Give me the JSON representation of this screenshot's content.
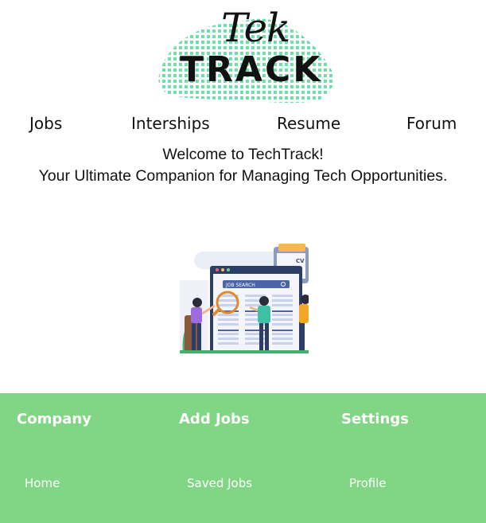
{
  "logo": {
    "line1": "Tek",
    "line2": "TRACK",
    "dot_colors": [
      "#4fd6e6",
      "#7be36b"
    ]
  },
  "nav": {
    "items": [
      {
        "label": "Jobs"
      },
      {
        "label": "Interships"
      },
      {
        "label": "Resume"
      },
      {
        "label": "Forum"
      }
    ]
  },
  "welcome": {
    "line1": "Welcome to TechTrack!",
    "line2": "Your Ultimate Companion for Managing Tech Opportunities."
  },
  "illustration": {
    "search_label": "JOB SEARCH",
    "cv_label": "CV"
  },
  "footer": {
    "background": "#80d684",
    "columns": [
      {
        "heading": "Company",
        "link": "Home"
      },
      {
        "heading": "Add Jobs",
        "link": "Saved Jobs"
      },
      {
        "heading": "Settings",
        "link": "Profile"
      }
    ]
  }
}
